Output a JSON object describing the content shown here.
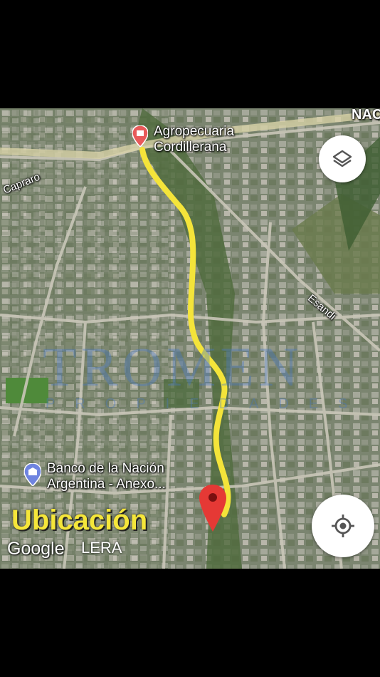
{
  "map": {
    "poi_top": {
      "name_line1": "Agropecuaria",
      "name_line2": "Cordillerana",
      "icon": "shopping-bag-pin-icon",
      "color": "#e85a5a"
    },
    "poi_bottom": {
      "name_line1": "Banco de la Nación",
      "name_line2": "Argentina - Anexo...",
      "icon": "bank-pin-icon",
      "color": "#6f84e0"
    },
    "streets": {
      "caparo": "Capraro",
      "esandi": "Esandi",
      "top_right": "NAC"
    },
    "route_color": "#f4e43a",
    "destination_pin": {
      "icon": "red-location-pin-icon",
      "color": "#e53935"
    },
    "layers_button": {
      "icon": "layers-icon"
    },
    "locate_button": {
      "icon": "my-location-icon"
    },
    "caption": "Ubicación",
    "google_logo": "Google",
    "logo_suffix": "LERA",
    "watermark": {
      "brand": "TROMEN",
      "sub": "PROPIEDADES"
    }
  }
}
